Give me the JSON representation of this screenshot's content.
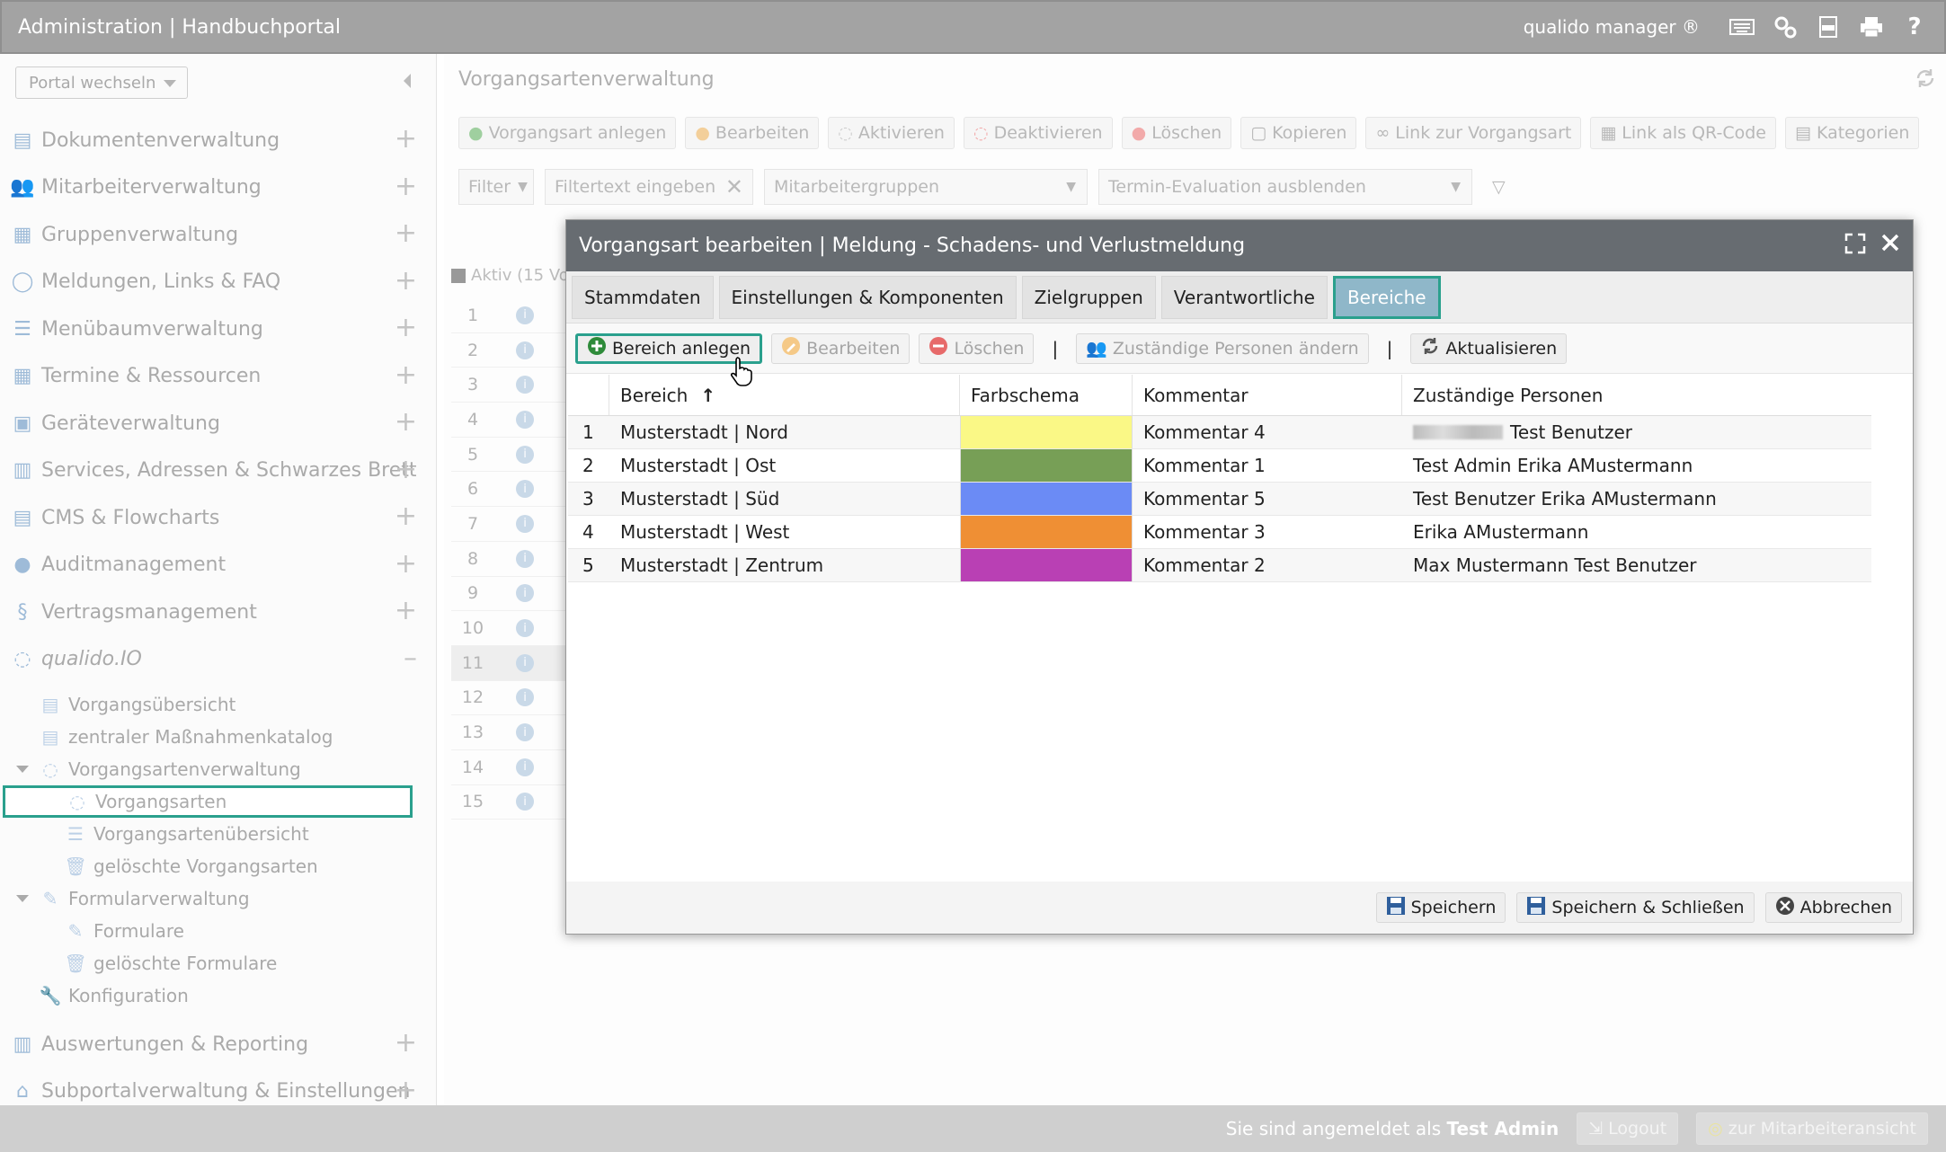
{
  "topbar": {
    "title": "Administration | Handbuchportal",
    "brand": "qualido manager ®"
  },
  "sidebar": {
    "portal_select": "Portal wechseln",
    "items": [
      "Dokumentenverwaltung",
      "Mitarbeiterverwaltung",
      "Gruppenverwaltung",
      "Meldungen, Links & FAQ",
      "Menübaumverwaltung",
      "Termine & Ressourcen",
      "Geräteverwaltung",
      "Services, Adressen & Schwarzes Brett",
      "CMS & Flowcharts",
      "Auditmanagement",
      "Vertragsmanagement",
      "qualido.IO"
    ],
    "sub": [
      "Vorgangsübersicht",
      "zentraler Maßnahmenkatalog",
      "Vorgangsartenverwaltung",
      "Vorgangsarten",
      "Vorgangsartenübersicht",
      "gelöschte Vorgangsarten",
      "Formularverwaltung",
      "Formulare",
      "gelöschte Formulare",
      "Konfiguration"
    ],
    "bottom_items": [
      "Auswertungen & Reporting",
      "Subportalverwaltung & Einstellungen"
    ]
  },
  "main": {
    "title": "Vorgangsartenverwaltung",
    "toolbar": [
      "Vorgangsart anlegen",
      "Bearbeiten",
      "Aktivieren",
      "Deaktivieren",
      "Löschen",
      "Kopieren",
      "Link zur Vorgangsart",
      "Link als QR-Code",
      "Kategorien"
    ],
    "filter": {
      "label": "Filter",
      "text_placeholder": "Filtertext eingeben",
      "groups": "Mitarbeitergruppen",
      "termin": "Termin-Evaluation ausblenden"
    },
    "group_label": "Aktiv (15 Vo",
    "rows": [
      "1",
      "2",
      "3",
      "4",
      "5",
      "6",
      "7",
      "8",
      "9",
      "10",
      "11",
      "12",
      "13",
      "14",
      "15"
    ]
  },
  "modal": {
    "title": "Vorgangsart bearbeiten | Meldung - Schadens- und Verlustmeldung",
    "tabs": [
      "Stammdaten",
      "Einstellungen & Komponenten",
      "Zielgruppen",
      "Verantwortliche",
      "Bereiche"
    ],
    "toolbar": {
      "add": "Bereich anlegen",
      "edit": "Bearbeiten",
      "delete": "Löschen",
      "persons": "Zuständige Personen ändern",
      "refresh": "Aktualisieren",
      "sep": "|"
    },
    "columns": [
      "Bereich",
      "Farbschema",
      "Kommentar",
      "Zuständige Personen"
    ],
    "sort_arrow": "🠕",
    "rows": [
      {
        "n": "1",
        "bereich": "Musterstadt | Nord",
        "color": "#faf886",
        "kommentar": "Kommentar 4",
        "personen": "Test Benutzer"
      },
      {
        "n": "2",
        "bereich": "Musterstadt | Ost",
        "color": "#779f56",
        "kommentar": "Kommentar 1",
        "personen": "Test Admin Erika AMustermann"
      },
      {
        "n": "3",
        "bereich": "Musterstadt | Süd",
        "color": "#6b8bf5",
        "kommentar": "Kommentar 5",
        "personen": "Test Benutzer Erika AMustermann"
      },
      {
        "n": "4",
        "bereich": "Musterstadt | West",
        "color": "#ef8f34",
        "kommentar": "Kommentar 3",
        "personen": "Erika AMustermann"
      },
      {
        "n": "5",
        "bereich": "Musterstadt | Zentrum",
        "color": "#b940b4",
        "kommentar": "Kommentar 2",
        "personen": "Max Mustermann Test Benutzer"
      }
    ],
    "footer": {
      "save": "Speichern",
      "save_close": "Speichern & Schließen",
      "cancel": "Abbrechen"
    }
  },
  "footer": {
    "logged_in": "Sie sind angemeldet als",
    "user": "Test Admin",
    "logout": "Logout",
    "employee_view": "zur Mitarbeiteransicht"
  }
}
